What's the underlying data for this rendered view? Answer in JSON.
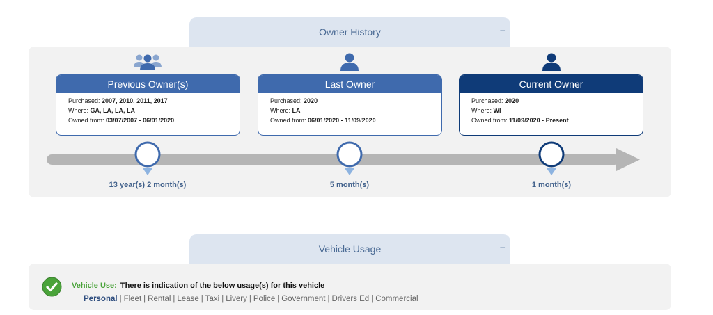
{
  "owner_history": {
    "tab_title": "Owner History",
    "collapse_symbol": "–",
    "owners": [
      {
        "title": "Previous Owner(s)",
        "purchased_label": "Purchased:",
        "purchased": "2007, 2010, 2011, 2017",
        "where_label": "Where:",
        "where": "GA, LA, LA, LA",
        "owned_label": "Owned from:",
        "owned": "03/07/2007 - 06/01/2020",
        "duration": "13 year(s) 2 month(s)",
        "icon": "group-icon"
      },
      {
        "title": "Last Owner",
        "purchased_label": "Purchased:",
        "purchased": "2020",
        "where_label": "Where:",
        "where": "LA",
        "owned_label": "Owned from:",
        "owned": "06/01/2020 - 11/09/2020",
        "duration": "5 month(s)",
        "icon": "person-icon"
      },
      {
        "title": "Current Owner",
        "purchased_label": "Purchased:",
        "purchased": "2020",
        "where_label": "Where:",
        "where": "WI",
        "owned_label": "Owned from:",
        "owned": "11/09/2020 - Present",
        "duration": "1 month(s)",
        "icon": "person-icon"
      }
    ]
  },
  "vehicle_usage": {
    "tab_title": "Vehicle Usage",
    "collapse_symbol": "–",
    "label": "Vehicle Use:",
    "text": "There is indication of the below usage(s) for this vehicle",
    "items": [
      "Personal",
      "Fleet",
      "Rental",
      "Lease",
      "Taxi",
      "Livery",
      "Police",
      "Government",
      "Drivers Ed",
      "Commercial"
    ],
    "active_item": "Personal",
    "icon": "check-circle-icon"
  },
  "colors": {
    "accent": "#3f6aad",
    "accent_dark": "#0f3b78",
    "timeline": "#b5b5b5",
    "usage_green": "#4aa33a",
    "tab_bg": "#dde5f0",
    "panel_bg": "#f2f2f2"
  }
}
